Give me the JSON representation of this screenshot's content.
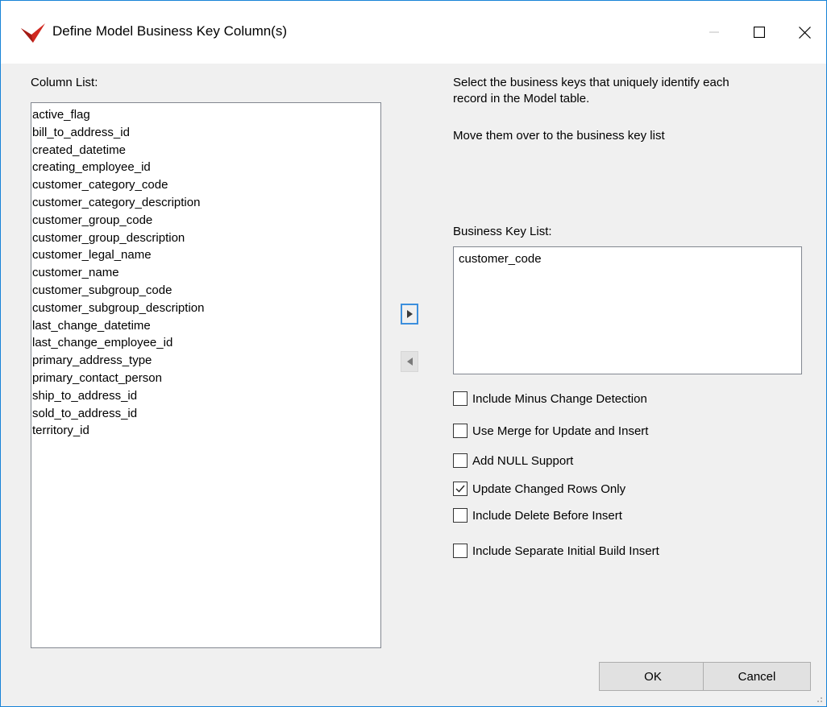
{
  "window": {
    "title": "Define Model Business Key Column(s)",
    "icon": "red-checkmark-logo-icon",
    "controls": {
      "minimize_icon": "minimize-icon",
      "maximize_icon": "maximize-icon",
      "close_icon": "close-icon"
    },
    "border_color": "#1883d7"
  },
  "column_list": {
    "label": "Column List:",
    "items": [
      "active_flag",
      "bill_to_address_id",
      "created_datetime",
      "creating_employee_id",
      "customer_category_code",
      "customer_category_description",
      "customer_group_code",
      "customer_group_description",
      "customer_legal_name",
      "customer_name",
      "customer_subgroup_code",
      "customer_subgroup_description",
      "last_change_datetime",
      "last_change_employee_id",
      "primary_address_type",
      "primary_contact_person",
      "ship_to_address_id",
      "sold_to_address_id",
      "territory_id"
    ]
  },
  "instructions": {
    "line1": "Select the business keys that uniquely identify each",
    "line2": "record in the Model table.",
    "line3": "Move them over to the business key list"
  },
  "move_buttons": {
    "add_icon": "arrow-right-icon",
    "remove_icon": "arrow-left-icon"
  },
  "business_key_list": {
    "label": "Business Key List:",
    "items": [
      "customer_code"
    ]
  },
  "options": [
    {
      "label": "Include Minus Change Detection",
      "checked": false
    },
    {
      "label": "Use Merge for Update and Insert",
      "checked": false
    },
    {
      "label": "Add NULL Support",
      "checked": false
    },
    {
      "label": "Update Changed Rows Only",
      "checked": true
    },
    {
      "label": "Include Delete Before Insert",
      "checked": false
    },
    {
      "label": "Include Separate Initial Build Insert",
      "checked": false
    }
  ],
  "buttons": {
    "ok": "OK",
    "cancel": "Cancel"
  }
}
